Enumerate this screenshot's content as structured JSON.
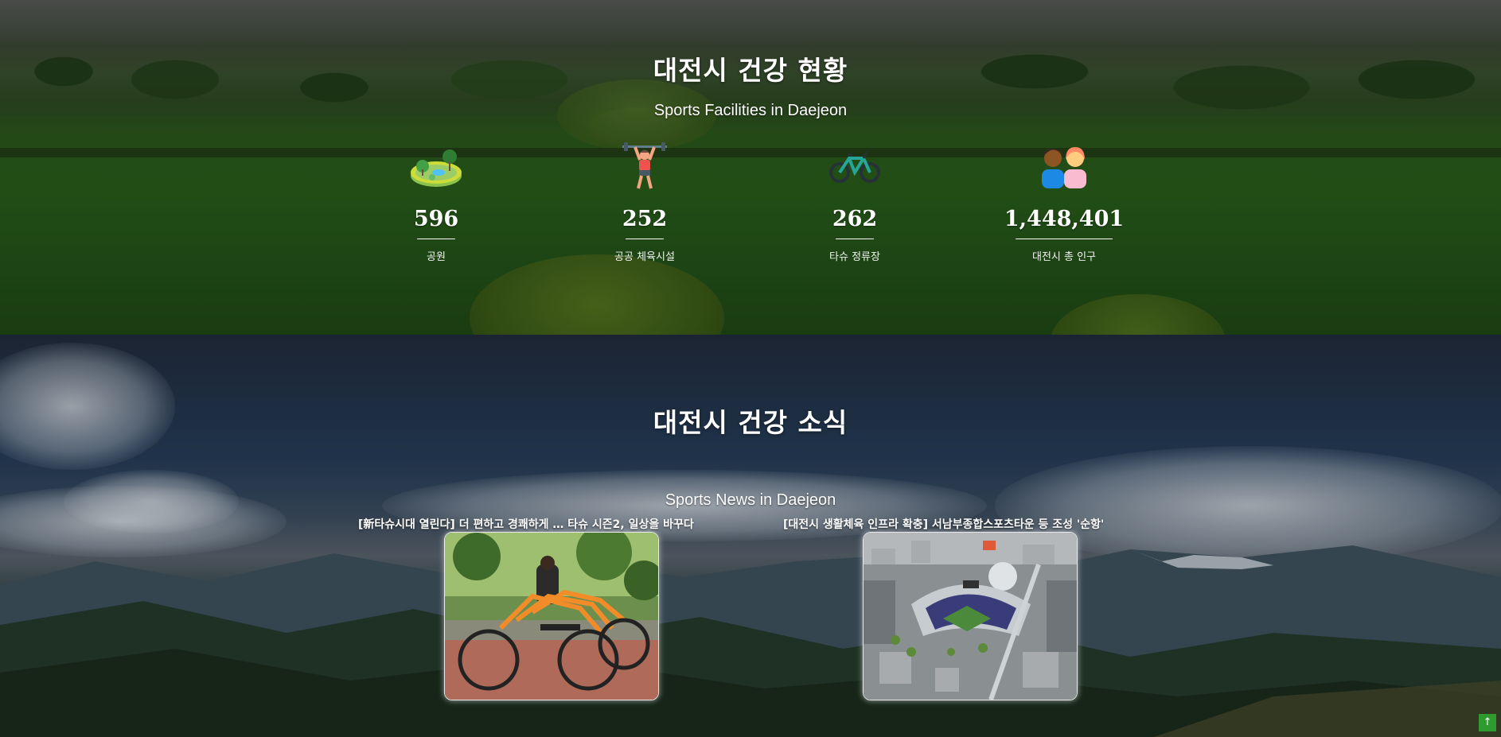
{
  "stats_section": {
    "title": "대전시 건강 현황",
    "subtitle": "Sports Facilities in Daejeon",
    "items": [
      {
        "icon": "park-icon",
        "value": "596",
        "label": "공원"
      },
      {
        "icon": "weightlifter-icon",
        "value": "252",
        "label": "공공 체육시설"
      },
      {
        "icon": "bicycle-icon",
        "value": "262",
        "label": "타슈 정류장"
      },
      {
        "icon": "people-icon",
        "value": "1,448,401",
        "label": "대전시 총 인구"
      }
    ]
  },
  "news_section": {
    "title": "대전시 건강 소식",
    "subtitle": "Sports News in Daejeon",
    "articles": [
      {
        "caption": "[新타슈시대 열린다] 더 편하고 경쾌하게 … 타슈 시즌2, 일상을 바꾸다",
        "thumbnail": "orange-bicycles-photo"
      },
      {
        "caption": "[대전시 생활체육 인프라 확충] 서남부종합스포츠타운 등 조성 '순항'",
        "thumbnail": "stadium-aerial-photo"
      }
    ]
  },
  "scroll_top": {
    "label": "↑"
  },
  "colors": {
    "accent_green": "#2e9b2e",
    "text_white": "#ffffff"
  }
}
